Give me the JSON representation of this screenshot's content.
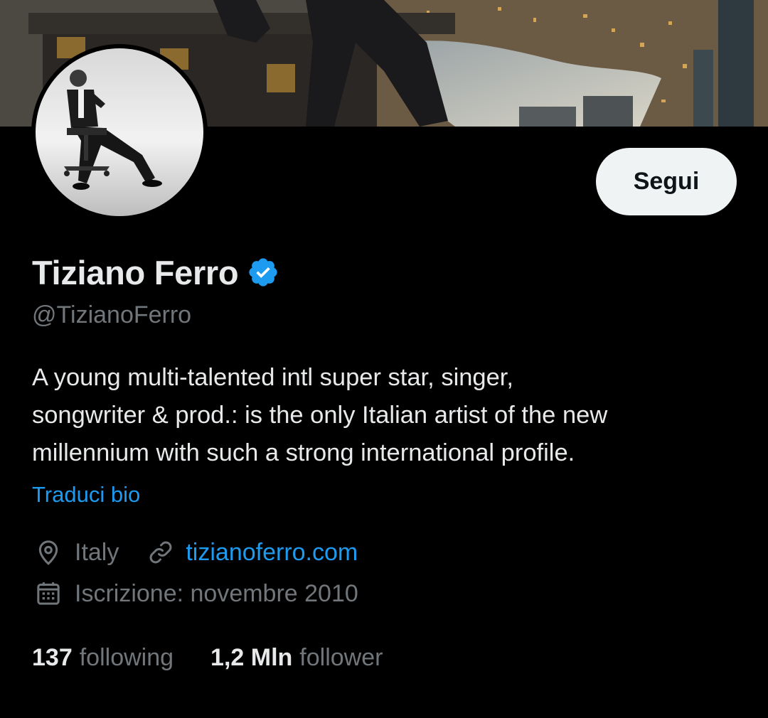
{
  "profile": {
    "display_name": "Tiziano Ferro",
    "handle": "@TizianoFerro",
    "verified": true,
    "bio_lines": [
      "A young multi-talented intl super star, singer,",
      "songwriter & prod.: is the only Italian artist of the new",
      "millennium with such a strong international profile."
    ],
    "translate_label": "Traduci bio",
    "location": "Italy",
    "website": "tizianoferro.com",
    "joined": "Iscrizione: novembre 2010"
  },
  "actions": {
    "follow_label": "Segui"
  },
  "stats": {
    "following_count": "137",
    "following_label": "following",
    "followers_count": "1,2 Mln",
    "followers_label": "follower"
  },
  "icons": {
    "verified": "verified-badge-icon",
    "location": "location-pin-icon",
    "link": "link-icon",
    "calendar": "calendar-icon"
  },
  "colors": {
    "background": "#000000",
    "text_primary": "#e7e9ea",
    "text_secondary": "#71767b",
    "accent": "#1d9bf0",
    "button_bg": "#eff3f4",
    "button_text": "#0f1419"
  }
}
